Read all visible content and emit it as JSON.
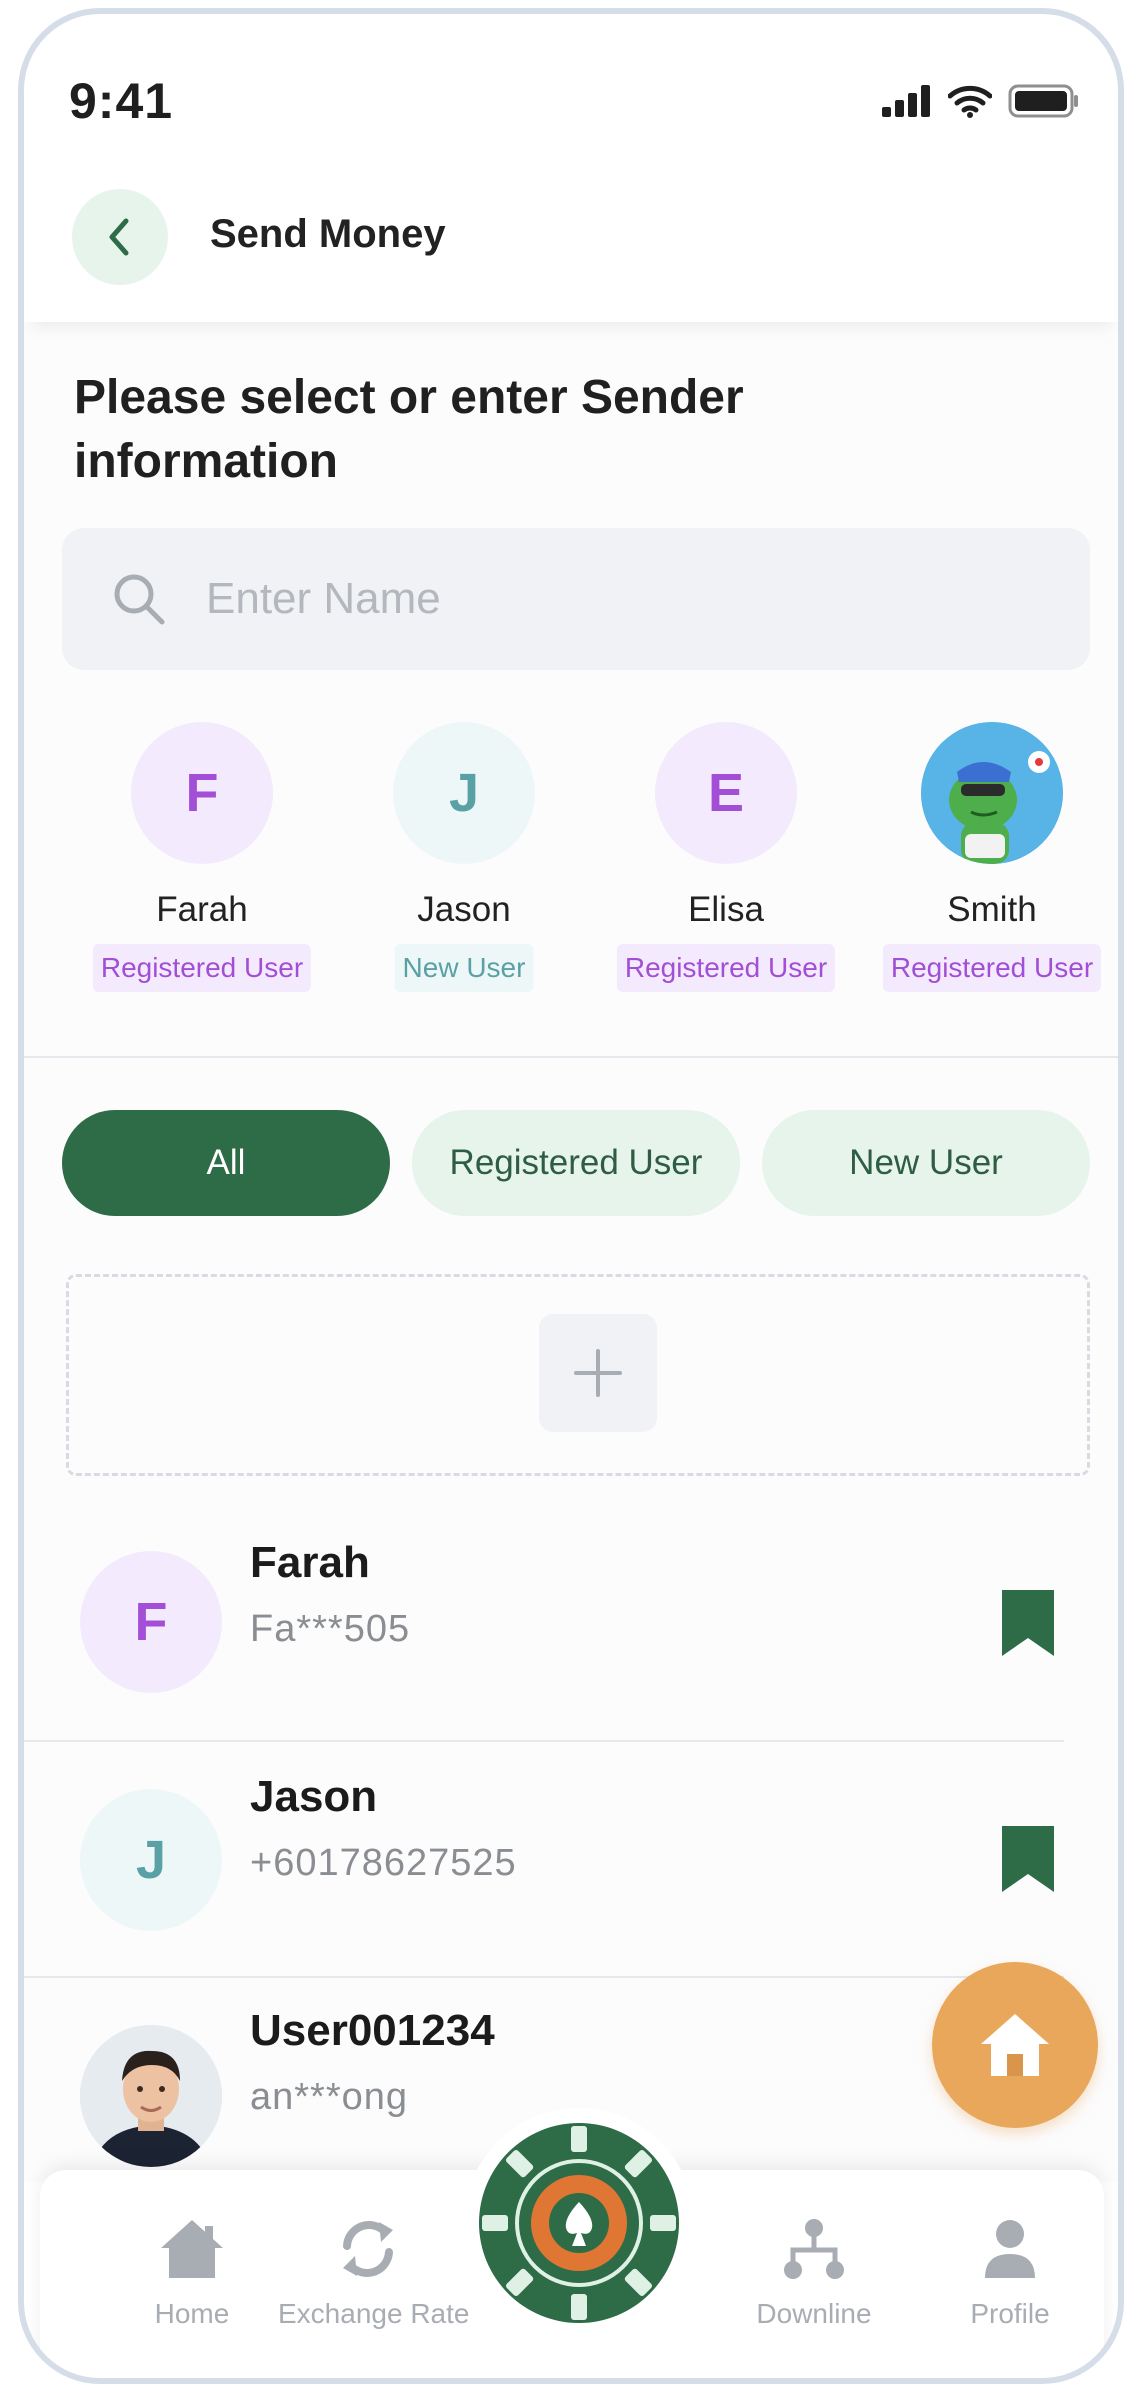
{
  "status_bar": {
    "time": "9:41",
    "icons": [
      "signal-icon",
      "wifi-icon",
      "battery-icon"
    ]
  },
  "header": {
    "back_icon": "chevron-left-icon",
    "title": "Send Money"
  },
  "prompt": {
    "title": "Please select or enter Sender information"
  },
  "search": {
    "placeholder": "Enter Name",
    "value": "",
    "icon": "search-icon"
  },
  "recent_contacts": [
    {
      "initial": "F",
      "name": "Farah",
      "badge": "Registered User",
      "avatar_type": "initial"
    },
    {
      "initial": "J",
      "name": "Jason",
      "badge": "New User",
      "avatar_type": "initial"
    },
    {
      "initial": "E",
      "name": "Elisa",
      "badge": "Registered User",
      "avatar_type": "initial"
    },
    {
      "initial": "",
      "name": "Smith",
      "badge": "Registered User",
      "avatar_type": "image"
    }
  ],
  "filters": [
    {
      "label": "All",
      "active": true
    },
    {
      "label": "Registered User",
      "active": false
    },
    {
      "label": "New User",
      "active": false
    }
  ],
  "add_contact": {
    "icon": "plus-icon"
  },
  "contacts": [
    {
      "initial": "F",
      "name": "Farah",
      "sub": "Fa***505",
      "bookmarked": true,
      "avatar_type": "initial"
    },
    {
      "initial": "J",
      "name": "Jason",
      "sub": "+60178627525",
      "bookmarked": true,
      "avatar_type": "initial"
    },
    {
      "initial": "",
      "name": "User001234",
      "sub": "an***ong",
      "bookmarked": false,
      "avatar_type": "photo"
    }
  ],
  "fab": {
    "icon": "home-icon"
  },
  "bottom_nav": [
    {
      "label": "Home",
      "icon": "home-icon"
    },
    {
      "label": "Exchange Rate",
      "icon": "refresh-icon"
    },
    {
      "label": "",
      "icon": "poker-chip-icon"
    },
    {
      "label": "Downline",
      "icon": "hierarchy-icon"
    },
    {
      "label": "Profile",
      "icon": "person-icon"
    }
  ],
  "colors": {
    "primary_green": "#2e6b47",
    "light_green": "#e6f4ec",
    "registered_purple": "#a24ed6",
    "registered_bg": "#f4eafd",
    "new_user_teal": "#5aa1a6",
    "new_user_bg": "#eef7f8",
    "fab_orange": "#e9a75b",
    "nav_gray": "#a8adb4"
  }
}
